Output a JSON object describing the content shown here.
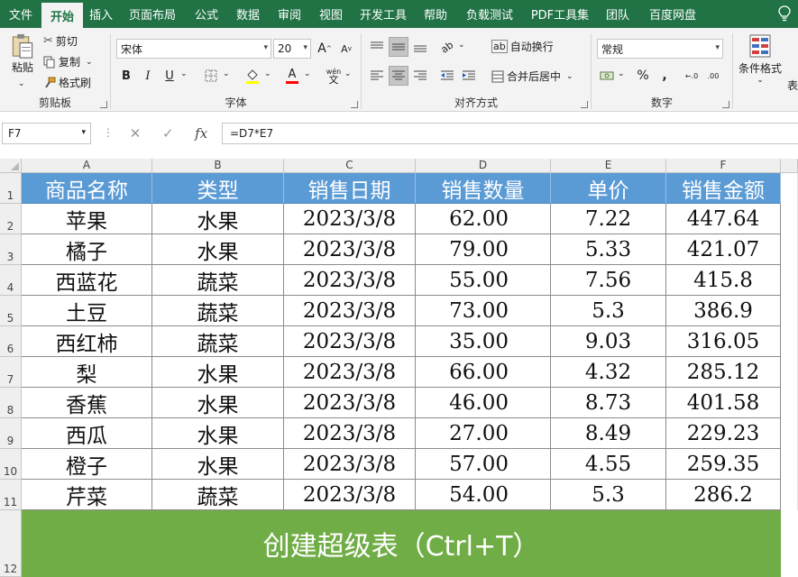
{
  "ribbon_tabs": [
    "文件",
    "开始",
    "插入",
    "页面布局",
    "公式",
    "数据",
    "审阅",
    "视图",
    "开发工具",
    "帮助",
    "负载测试",
    "PDF工具集",
    "团队",
    "百度网盘"
  ],
  "active_tab": "开始",
  "clipboard": {
    "paste": "粘贴",
    "cut": "剪切",
    "copy": "复制",
    "format_painter": "格式刷",
    "group_label": "剪贴板"
  },
  "font": {
    "name": "宋体",
    "size": "20",
    "bold": "B",
    "italic": "I",
    "underline": "U",
    "grow": "A",
    "shrink": "A",
    "font_color_letter": "A",
    "wen": "wén",
    "group_label": "字体"
  },
  "alignment": {
    "wrap_text": "自动换行",
    "merge_center": "合并后居中",
    "group_label": "对齐方式"
  },
  "number": {
    "format": "常规",
    "percent": "%",
    "comma": ",",
    "inc_dec": "←.0",
    "dec_dec": ".00",
    "group_label": "数字"
  },
  "styles": {
    "conditional_format": "条件格式",
    "partial": "表"
  },
  "formula_bar": {
    "name_box": "F7",
    "cancel": "✕",
    "enter": "✓",
    "fx": "fx",
    "formula": "=D7*E7"
  },
  "columns": [
    "A",
    "B",
    "C",
    "D",
    "E",
    "F"
  ],
  "row_numbers": [
    "1",
    "2",
    "3",
    "4",
    "5",
    "6",
    "7",
    "8",
    "9",
    "10",
    "11",
    "12"
  ],
  "table": {
    "headers": [
      "商品名称",
      "类型",
      "销售日期",
      "销售数量",
      "单价",
      "销售金额"
    ],
    "rows": [
      [
        "苹果",
        "水果",
        "2023/3/8",
        "62.00",
        "7.22",
        "447.64"
      ],
      [
        "橘子",
        "水果",
        "2023/3/8",
        "79.00",
        "5.33",
        "421.07"
      ],
      [
        "西蓝花",
        "蔬菜",
        "2023/3/8",
        "55.00",
        "7.56",
        "415.8"
      ],
      [
        "土豆",
        "蔬菜",
        "2023/3/8",
        "73.00",
        "5.3",
        "386.9"
      ],
      [
        "西红柿",
        "蔬菜",
        "2023/3/8",
        "35.00",
        "9.03",
        "316.05"
      ],
      [
        "梨",
        "水果",
        "2023/3/8",
        "66.00",
        "4.32",
        "285.12"
      ],
      [
        "香蕉",
        "水果",
        "2023/3/8",
        "46.00",
        "8.73",
        "401.58"
      ],
      [
        "西瓜",
        "水果",
        "2023/3/8",
        "27.00",
        "8.49",
        "229.23"
      ],
      [
        "橙子",
        "水果",
        "2023/3/8",
        "57.00",
        "4.55",
        "259.35"
      ],
      [
        "芹菜",
        "蔬菜",
        "2023/3/8",
        "54.00",
        "5.3",
        "286.2"
      ]
    ]
  },
  "banner_text": "创建超级表（Ctrl+T）",
  "colors": {
    "ribbon_green": "#217346",
    "header_blue": "#5b9bd5",
    "banner_green": "#70ad47"
  }
}
